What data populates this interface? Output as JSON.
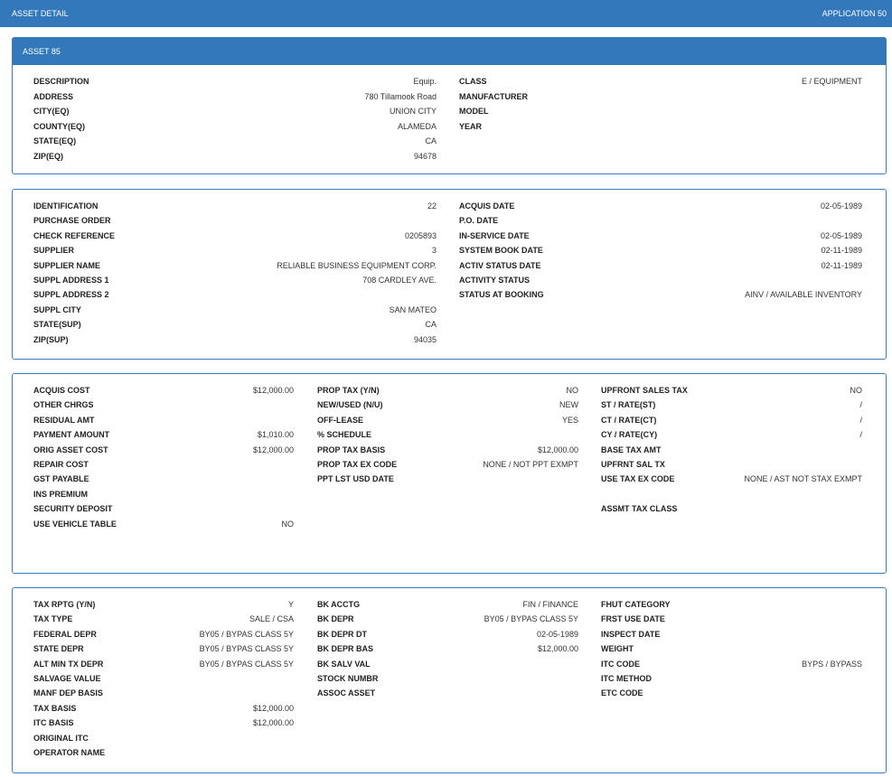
{
  "header": {
    "title": "ASSET DETAIL",
    "app": "APPLICATION 50"
  },
  "panel1": {
    "title": "ASSET 85",
    "left": [
      {
        "label": "DESCRIPTION",
        "value": "Equip."
      },
      {
        "label": "ADDRESS",
        "value": "780 Tillamook Road"
      },
      {
        "label": "CITY(EQ)",
        "value": "UNION CITY"
      },
      {
        "label": "COUNTY(EQ)",
        "value": "ALAMEDA"
      },
      {
        "label": "STATE(EQ)",
        "value": "CA"
      },
      {
        "label": "ZIP(EQ)",
        "value": "94678"
      }
    ],
    "right": [
      {
        "label": "CLASS",
        "value": "E / EQUIPMENT"
      },
      {
        "label": "MANUFACTURER",
        "value": ""
      },
      {
        "label": "MODEL",
        "value": ""
      },
      {
        "label": "YEAR",
        "value": ""
      }
    ]
  },
  "panel2": {
    "left": [
      {
        "label": "IDENTIFICATION",
        "value": "22"
      },
      {
        "label": "PURCHASE ORDER",
        "value": ""
      },
      {
        "label": "CHECK REFERENCE",
        "value": "0205893"
      },
      {
        "label": "SUPPLIER",
        "value": "3"
      },
      {
        "label": "SUPPLIER NAME",
        "value": "RELIABLE BUSINESS EQUIPMENT CORP."
      },
      {
        "label": "SUPPL ADDRESS 1",
        "value": "708 CARDLEY AVE."
      },
      {
        "label": "SUPPL ADDRESS 2",
        "value": ""
      },
      {
        "label": "SUPPL CITY",
        "value": "SAN MATEO"
      },
      {
        "label": "STATE(SUP)",
        "value": "CA"
      },
      {
        "label": "ZIP(SUP)",
        "value": "94035"
      }
    ],
    "right": [
      {
        "label": "ACQUIS DATE",
        "value": "02-05-1989"
      },
      {
        "label": "P.O. DATE",
        "value": ""
      },
      {
        "label": "IN-SERVICE DATE",
        "value": "02-05-1989"
      },
      {
        "label": "SYSTEM BOOK DATE",
        "value": "02-11-1989"
      },
      {
        "label": "ACTIV STATUS DATE",
        "value": "02-11-1989"
      },
      {
        "label": "ACTIVITY STATUS",
        "value": ""
      },
      {
        "label": "STATUS AT BOOKING",
        "value": "AINV / AVAILABLE INVENTORY"
      }
    ]
  },
  "panel3": {
    "col1": [
      {
        "label": "ACQUIS COST",
        "value": "$12,000.00"
      },
      {
        "label": "OTHER CHRGS",
        "value": ""
      },
      {
        "label": "RESIDUAL AMT",
        "value": ""
      },
      {
        "label": "PAYMENT AMOUNT",
        "value": "$1,010.00"
      },
      {
        "label": "ORIG ASSET COST",
        "value": "$12,000.00"
      },
      {
        "label": "REPAIR COST",
        "value": ""
      },
      {
        "label": "GST PAYABLE",
        "value": ""
      },
      {
        "label": "INS PREMIUM",
        "value": ""
      },
      {
        "label": "SECURITY DEPOSIT",
        "value": ""
      },
      {
        "label": "USE VEHICLE TABLE",
        "value": "NO"
      }
    ],
    "col2": [
      {
        "label": "PROP TAX (Y/N)",
        "value": "NO"
      },
      {
        "label": "NEW/USED (N/U)",
        "value": "NEW"
      },
      {
        "label": "OFF-LEASE",
        "value": "YES"
      },
      {
        "label": "% SCHEDULE",
        "value": ""
      },
      {
        "label": "PROP TAX BASIS",
        "value": "$12,000.00"
      },
      {
        "label": "PROP TAX EX CODE",
        "value": "NONE / NOT PPT EXMPT"
      },
      {
        "label": "PPT LST USD DATE",
        "value": ""
      }
    ],
    "col3": [
      {
        "label": "UPFRONT SALES TAX",
        "value": "NO"
      },
      {
        "label": "ST / RATE(ST)",
        "value": "/"
      },
      {
        "label": "CT / RATE(CT)",
        "value": "/"
      },
      {
        "label": "CY / RATE(CY)",
        "value": "/"
      },
      {
        "label": "BASE TAX AMT",
        "value": ""
      },
      {
        "label": "UPFRNT SAL TX",
        "value": ""
      },
      {
        "label": "USE TAX EX CODE",
        "value": "NONE / AST NOT STAX EXMPT"
      },
      {
        "label": "",
        "value": ""
      },
      {
        "label": "ASSMT TAX CLASS",
        "value": ""
      }
    ]
  },
  "panel4": {
    "col1": [
      {
        "label": "TAX RPTG (Y/N)",
        "value": "Y"
      },
      {
        "label": "TAX TYPE",
        "value": "SALE / CSA"
      },
      {
        "label": "FEDERAL DEPR",
        "value": "BY05 / BYPAS CLASS 5Y"
      },
      {
        "label": "STATE DEPR",
        "value": "BY05 / BYPAS CLASS 5Y"
      },
      {
        "label": "ALT MIN TX DEPR",
        "value": "BY05 / BYPAS CLASS 5Y"
      },
      {
        "label": "SALVAGE VALUE",
        "value": ""
      },
      {
        "label": "MANF DEP BASIS",
        "value": ""
      },
      {
        "label": "TAX BASIS",
        "value": "$12,000.00"
      },
      {
        "label": "ITC BASIS",
        "value": "$12,000.00"
      },
      {
        "label": "ORIGINAL ITC",
        "value": ""
      },
      {
        "label": "OPERATOR NAME",
        "value": ""
      }
    ],
    "col2": [
      {
        "label": "BK ACCTG",
        "value": "FIN / FINANCE"
      },
      {
        "label": "BK DEPR",
        "value": "BY05 / BYPAS CLASS 5Y"
      },
      {
        "label": "BK DEPR DT",
        "value": "02-05-1989"
      },
      {
        "label": "BK DEPR BAS",
        "value": "$12,000.00"
      },
      {
        "label": "BK SALV VAL",
        "value": ""
      },
      {
        "label": "STOCK NUMBR",
        "value": ""
      },
      {
        "label": "ASSOC ASSET",
        "value": ""
      }
    ],
    "col3": [
      {
        "label": "FHUT CATEGORY",
        "value": ""
      },
      {
        "label": "FRST USE DATE",
        "value": ""
      },
      {
        "label": "INSPECT DATE",
        "value": ""
      },
      {
        "label": "WEIGHT",
        "value": ""
      },
      {
        "label": "ITC CODE",
        "value": "BYPS / BYPASS"
      },
      {
        "label": "ITC METHOD",
        "value": ""
      },
      {
        "label": "ETC CODE",
        "value": ""
      }
    ]
  }
}
